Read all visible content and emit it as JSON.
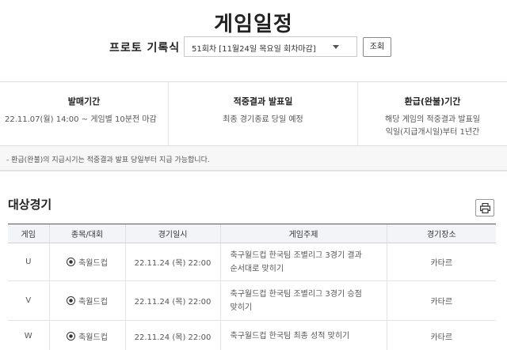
{
  "page": {
    "title": "게임일정"
  },
  "round": {
    "label": "프로토 기록식",
    "selected": "51회차 [11월24일 목요일 회차마감]",
    "search_label": "조회"
  },
  "info": [
    {
      "heading": "발매기간",
      "lines": [
        "22.11.07(월) 14:00 ~ 게임별 10분전 마감"
      ]
    },
    {
      "heading": "적중결과 발표일",
      "lines": [
        "최종 경기종료 당일 예정"
      ]
    },
    {
      "heading": "환급(완불)기간",
      "lines": [
        "해당 게임의 적중결과 발표일",
        "익일(지급개시일)부터 1년간"
      ]
    }
  ],
  "notice": "- 환급(완불)의 지급시기는 적중결과 발표 당일부터 지급 가능합니다.",
  "section": {
    "title": "대상경기",
    "print_icon": "printer-icon"
  },
  "table": {
    "headers": [
      "게임",
      "종목/대회",
      "경기일시",
      "게임주제",
      "경기장소"
    ],
    "rows": [
      {
        "game": "U",
        "sport": "축월드컵",
        "datetime": "22.11.24 (목) 22:00",
        "subject": [
          "축구월드컵 한국팀 조별리그 3경기 결과",
          "순서대로 맞히기"
        ],
        "venue": "카타르"
      },
      {
        "game": "V",
        "sport": "축월드컵",
        "datetime": "22.11.24 (목) 22:00",
        "subject": [
          "축구월드컵 한국팀 조별리그 3경기 승점",
          "맞히기"
        ],
        "venue": "카타르"
      },
      {
        "game": "W",
        "sport": "축월드컵",
        "datetime": "22.11.24 (목) 22:00",
        "subject": [
          "축구월드컵 한국팀 최종 성적 맞히기"
        ],
        "venue": "카타르"
      }
    ]
  }
}
